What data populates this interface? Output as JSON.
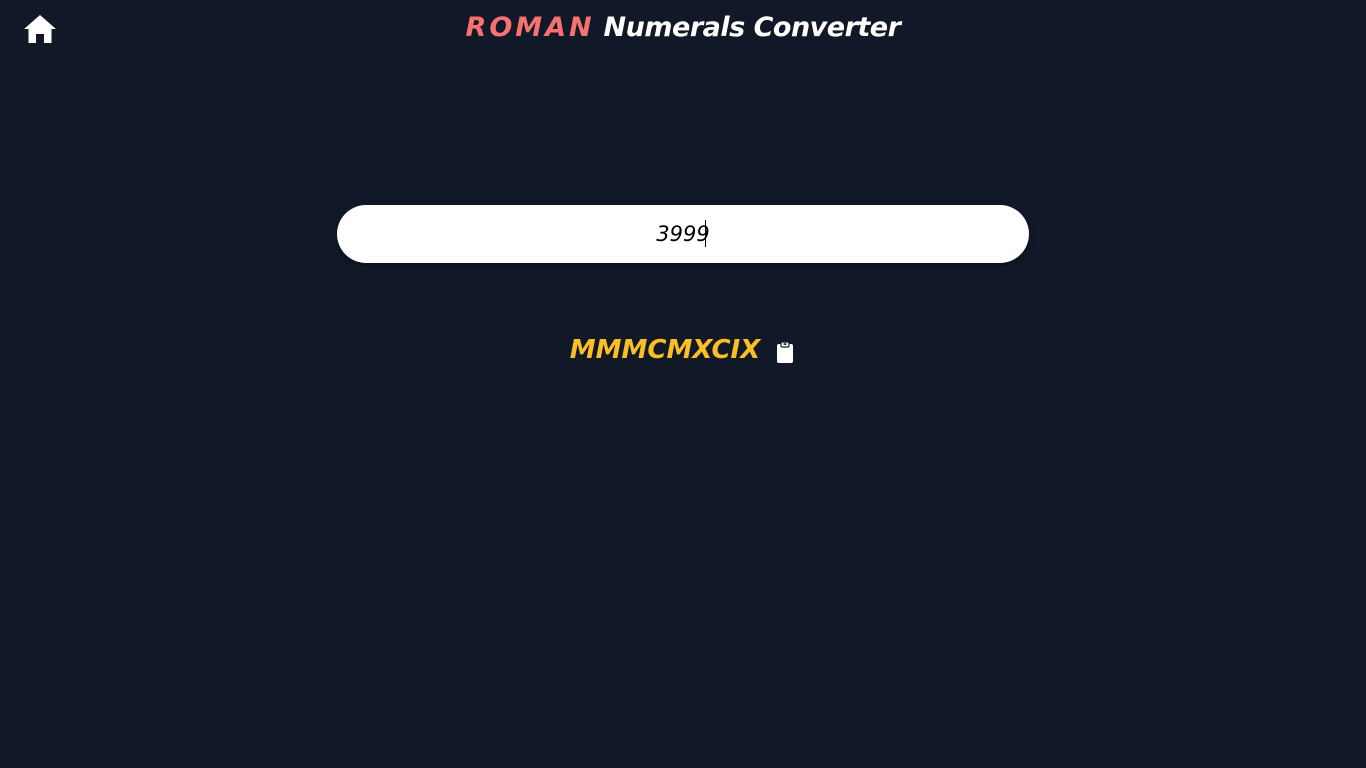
{
  "header": {
    "title_accent": "ROMAN",
    "title_rest": " Numerals Converter",
    "home_icon": "home-icon"
  },
  "converter": {
    "input_value": "3999",
    "result": "MMMCMXCIX",
    "copy_icon": "clipboard-icon"
  },
  "colors": {
    "background": "#111827",
    "accent_title": "#f87171",
    "result_text": "#fbbf24",
    "input_background": "#ffffff"
  }
}
